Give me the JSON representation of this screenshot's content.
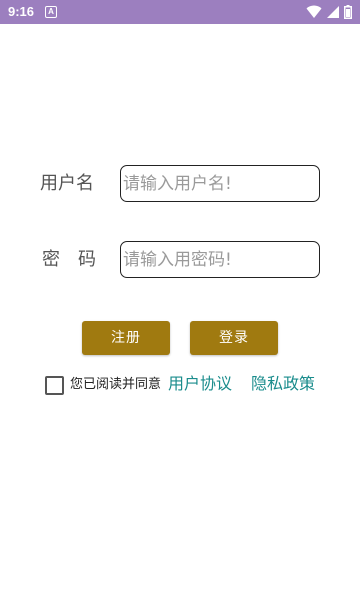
{
  "status_bar": {
    "time": "9:16",
    "notification_icon": "a-icon",
    "icons": [
      "wifi-icon",
      "signal-icon",
      "battery-icon"
    ],
    "background": "#9c7fbf"
  },
  "form": {
    "username_label": "用户名",
    "username_placeholder": "请输入用户名!",
    "password_label": "密码",
    "password_placeholder": "请输入用密码!"
  },
  "buttons": {
    "register": "注册",
    "login": "登录",
    "color": "#a07a10"
  },
  "agreement": {
    "checked": false,
    "text": "您已阅读并同意",
    "user_agreement": "用户协议",
    "privacy_policy": "隐私政策",
    "link_color": "#1a8c8c"
  }
}
